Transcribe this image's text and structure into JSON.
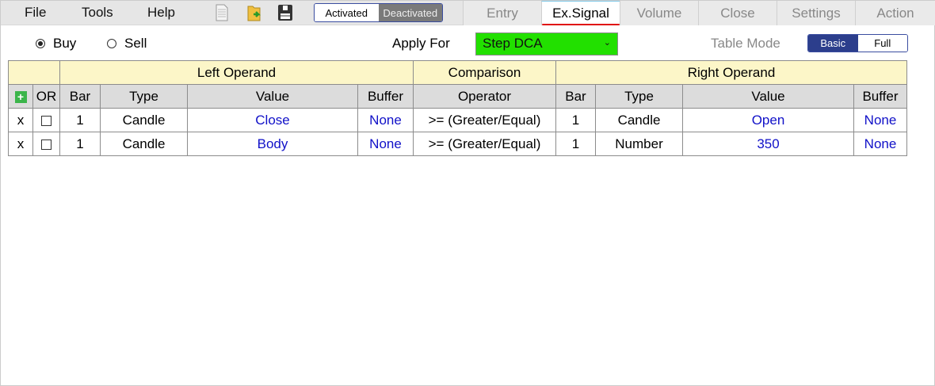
{
  "menu": {
    "file": "File",
    "tools": "Tools",
    "help": "Help"
  },
  "toggle": {
    "activated": "Activated",
    "deactivated": "Deactivated"
  },
  "tabs": [
    "Entry",
    "Ex.Signal",
    "Volume",
    "Close",
    "Settings",
    "Action"
  ],
  "side": {
    "buy": "Buy",
    "sell": "Sell"
  },
  "apply_for": {
    "label": "Apply For",
    "value": "Step DCA"
  },
  "table_mode": {
    "label": "Table Mode",
    "basic": "Basic",
    "full": "Full"
  },
  "table": {
    "groups": {
      "left": "Left Operand",
      "comparison": "Comparison",
      "right": "Right Operand"
    },
    "headers": {
      "add": "+",
      "or": "OR",
      "bar": "Bar",
      "type": "Type",
      "value": "Value",
      "buffer": "Buffer",
      "operator": "Operator"
    },
    "rows": [
      {
        "del": "x",
        "lbar": "1",
        "ltype": "Candle",
        "lvalue": "Close",
        "lbuf": "None",
        "op": ">= (Greater/Equal)",
        "rbar": "1",
        "rtype": "Candle",
        "rvalue": "Open",
        "rbuf": "None"
      },
      {
        "del": "x",
        "lbar": "1",
        "ltype": "Candle",
        "lvalue": "Body",
        "lbuf": "None",
        "op": ">= (Greater/Equal)",
        "rbar": "1",
        "rtype": "Number",
        "rvalue": "350",
        "rbuf": "None"
      }
    ]
  }
}
